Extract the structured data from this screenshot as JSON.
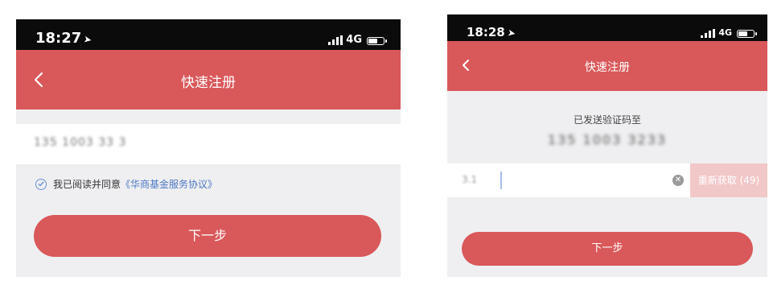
{
  "left": {
    "status": {
      "time": "18:27",
      "network": "4G"
    },
    "nav": {
      "title": "快速注册"
    },
    "phone_input": {
      "value": "135 1003 33 3"
    },
    "agreement": {
      "text": "我已阅读并同意",
      "link": "《华商基金服务协议》"
    },
    "next_button": "下一步"
  },
  "right": {
    "status": {
      "time": "18:28",
      "network": "4G"
    },
    "nav": {
      "title": "快速注册"
    },
    "sent_label": "已发送验证码至",
    "phone_number": "135 1003 3233",
    "code_input": {
      "value": "3.1"
    },
    "resend_button": "重新获取 (49)",
    "next_button": "下一步"
  },
  "icons": {
    "back": "chevron-left-icon",
    "location": "location-arrow-icon",
    "signal": "signal-icon",
    "battery": "battery-icon",
    "check": "check-circle-icon",
    "clear": "clear-icon"
  },
  "colors": {
    "primary_red": "#d9585a",
    "resend_disabled": "#f2c7c7",
    "link_blue": "#4d78c5",
    "page_bg": "#efeff1"
  }
}
